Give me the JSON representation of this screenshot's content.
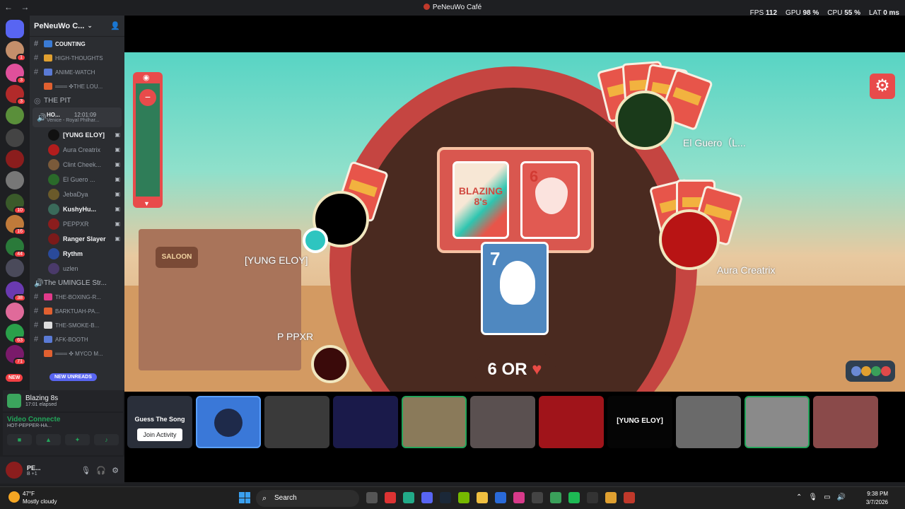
{
  "window": {
    "title": "PeNeuWo Café",
    "back": "←",
    "forward": "→"
  },
  "stats": {
    "fps_label": "FPS",
    "fps": "112",
    "gpu_label": "GPU",
    "gpu": "98 %",
    "cpu_label": "CPU",
    "cpu": "55 %",
    "lat_label": "LAT",
    "lat": "0 ms"
  },
  "server": {
    "name": "PeNeuWo C...",
    "chevron": "⌄",
    "invite_icon": "person-add-icon"
  },
  "channels": [
    {
      "label": "COUNTING",
      "bold": true
    },
    {
      "label": "HIGH-THOUGHTS"
    },
    {
      "label": "ANIME-WATCH"
    },
    {
      "label": "═══ ✜THE LOU..."
    },
    {
      "label": "THE PIT",
      "category": true
    },
    {
      "label": "HO...",
      "time": "12:01:09",
      "sub": "Venice - Royal Philhar..."
    }
  ],
  "voice_users": [
    "[YUNG ELOY]",
    "Aura Creatrix",
    "Clint Cheek...",
    "El Guero ...",
    "JebaDya",
    "KushyHu...",
    "PEPPXR",
    "Ranger Slayer",
    "Rythm",
    "uzlen"
  ],
  "channels2": [
    {
      "label": "The UMINGLE Str...",
      "category": true
    },
    {
      "label": "THE-BOXING-R..."
    },
    {
      "label": "BARKTUAH-PA..."
    },
    {
      "label": "THE-SMOKE-B..."
    },
    {
      "label": "AFK-BOOTH"
    },
    {
      "label": "═══ ✜ MYCO M..."
    }
  ],
  "new_unreads": "NEW UNREADS",
  "new_badge": "NEW",
  "activity": {
    "name": "Blazing 8s",
    "elapsed": "17:01 elapsed"
  },
  "voice": {
    "status": "Video Connecte",
    "channel": "HOT-PEPPER-HA..."
  },
  "user": {
    "name": "PE...",
    "status": "B +1"
  },
  "game": {
    "deck_label": "BLAZING 8's",
    "top_card": "6",
    "active_card": "7",
    "call_number": "6 OR",
    "call_suit": "♥",
    "players": [
      {
        "name": "[YUNG ELOY]"
      },
      {
        "name": "El Guero（L..."
      },
      {
        "name": "Aura Creatrix"
      },
      {
        "name": "P PPXR"
      }
    ],
    "saloon": "SALOON"
  },
  "tiles": [
    {
      "title": "Guess The Song",
      "button": "Join Activity"
    },
    {
      "title": ""
    },
    {
      "title": ""
    },
    {
      "title": ""
    },
    {
      "title": ""
    },
    {
      "title": ""
    },
    {
      "title": ""
    },
    {
      "title": "[YUNG ELOY]"
    },
    {
      "title": ""
    },
    {
      "title": ""
    },
    {
      "title": ""
    }
  ],
  "taskbar": {
    "temp": "47°F",
    "weather": "Mostly cloudy",
    "search": "Search",
    "time": "9:38 PM",
    "date": "3/7/2026"
  },
  "rail_badges": [
    "1",
    "3",
    "3",
    "10",
    "16",
    "44",
    "38",
    "63",
    "71"
  ]
}
